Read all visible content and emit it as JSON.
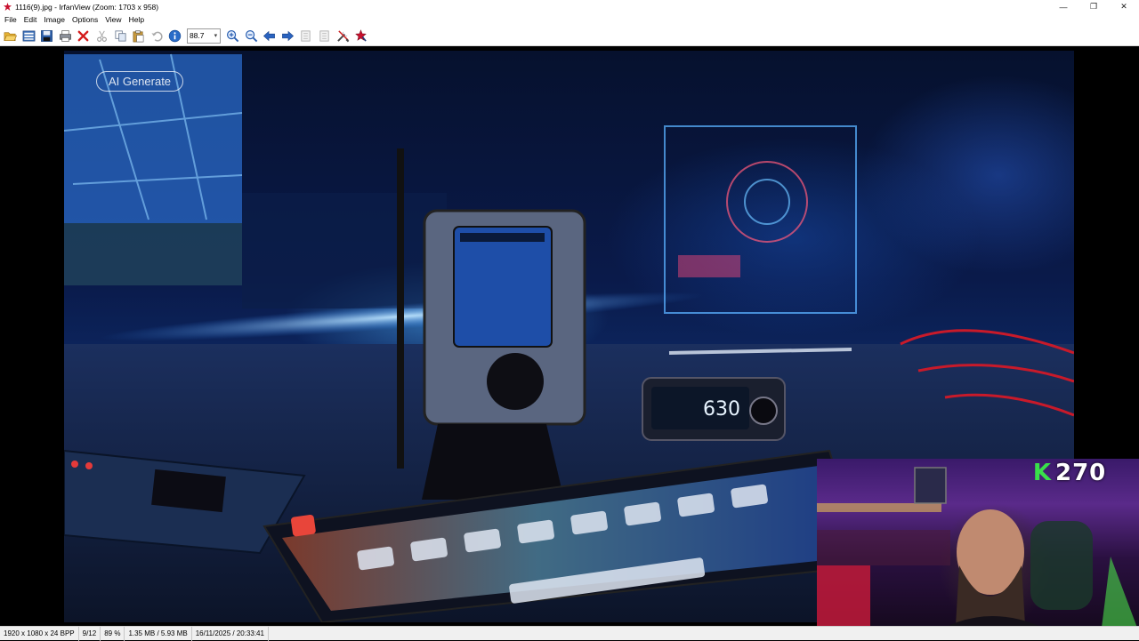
{
  "window": {
    "title": "1116(9).jpg - IrfanView (Zoom: 1703 x 958)",
    "minimize_symbol": "—",
    "restore_symbol": "❐",
    "close_symbol": "✕"
  },
  "menu": [
    {
      "label": "File"
    },
    {
      "label": "Edit"
    },
    {
      "label": "Image"
    },
    {
      "label": "Options"
    },
    {
      "label": "View"
    },
    {
      "label": "Help"
    }
  ],
  "toolbar": {
    "zoom_value": "88.7",
    "zoom_dropdown_symbol": "▾",
    "icons": [
      "open-folder-icon",
      "thumbnails-icon",
      "save-icon",
      "print-icon",
      "delete-icon",
      "cut-icon",
      "copy-icon",
      "paste-icon",
      "undo-icon",
      "info-icon",
      "zoom-in-icon",
      "zoom-out-icon",
      "previous-icon",
      "next-icon",
      "first-page-icon",
      "last-page-icon",
      "settings-icon",
      "exit-icon"
    ]
  },
  "image": {
    "watermark": "AI Generate",
    "device_readout": "630"
  },
  "statusbar": {
    "dimensions": "1920 x 1080 x 24 BPP",
    "index": "9/12",
    "zoom": "89 %",
    "size": "1.35 MB / 5.93 MB",
    "datetime": "16/11/2025 / 20:33:41"
  },
  "overlay": {
    "counter_letter": "K",
    "counter_value": "270"
  },
  "colors": {
    "accent_green": "#39e04a",
    "irfan_red": "#c8102e"
  }
}
